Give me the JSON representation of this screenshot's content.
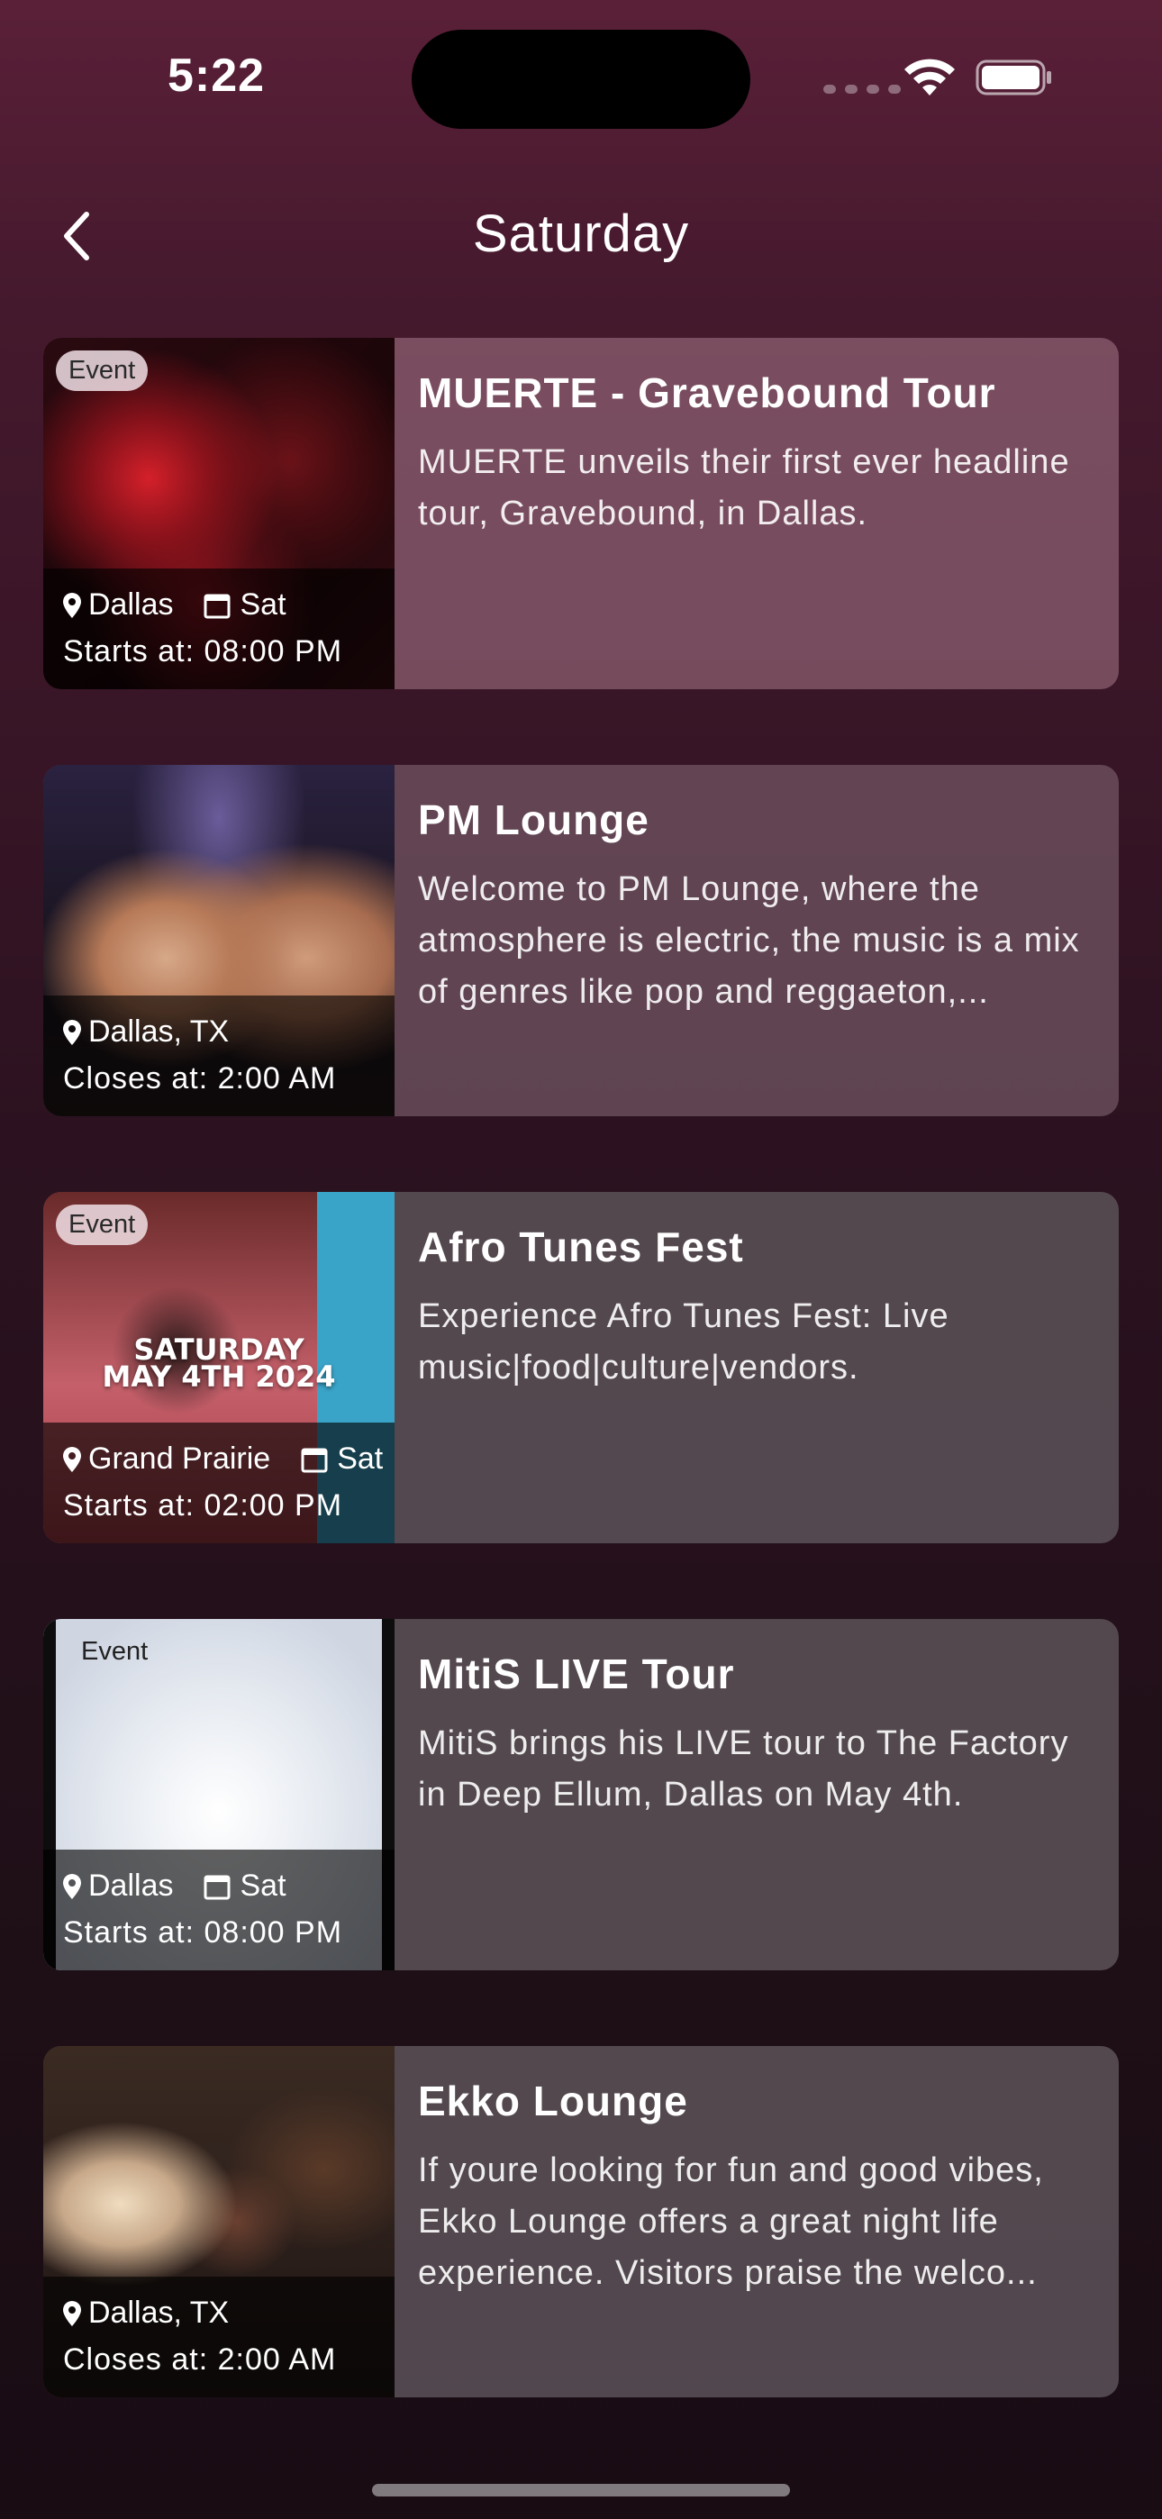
{
  "status_bar": {
    "time": "5:22"
  },
  "nav": {
    "title": "Saturday"
  },
  "cards": [
    {
      "badge": "Event",
      "location": "Dallas",
      "day": "Sat",
      "time_line": "Starts at: 08:00 PM",
      "title": "MUERTE - Gravebound Tour",
      "description": "MUERTE unveils their first ever headline tour, Gravebound, in Dallas."
    },
    {
      "location": "Dallas, TX",
      "time_line": "Closes at: 2:00 AM",
      "title": "PM Lounge",
      "description": "Welcome to PM Lounge, where the atmosphere is electric, the music is a mix of genres like pop and reggaeton,..."
    },
    {
      "badge": "Event",
      "image_text_1": "SATURDAY",
      "image_text_2": "MAY 4TH 2024",
      "location": "Grand Prairie",
      "day": "Sat",
      "time_line": "Starts at: 02:00 PM",
      "title": "Afro Tunes Fest",
      "description": "Experience Afro Tunes Fest: Live music|food|culture|vendors."
    },
    {
      "badge": "Event",
      "location": "Dallas",
      "day": "Sat",
      "time_line": "Starts at: 08:00 PM",
      "title": "MitiS LIVE Tour",
      "description": "MitiS brings his LIVE tour to The Factory in Deep Ellum, Dallas on May 4th."
    },
    {
      "location": "Dallas, TX",
      "time_line": "Closes at: 2:00 AM",
      "title": "Ekko Lounge",
      "description": "If youre looking for fun and good vibes, Ekko Lounge offers a great night life experience. Visitors praise the welco..."
    }
  ]
}
